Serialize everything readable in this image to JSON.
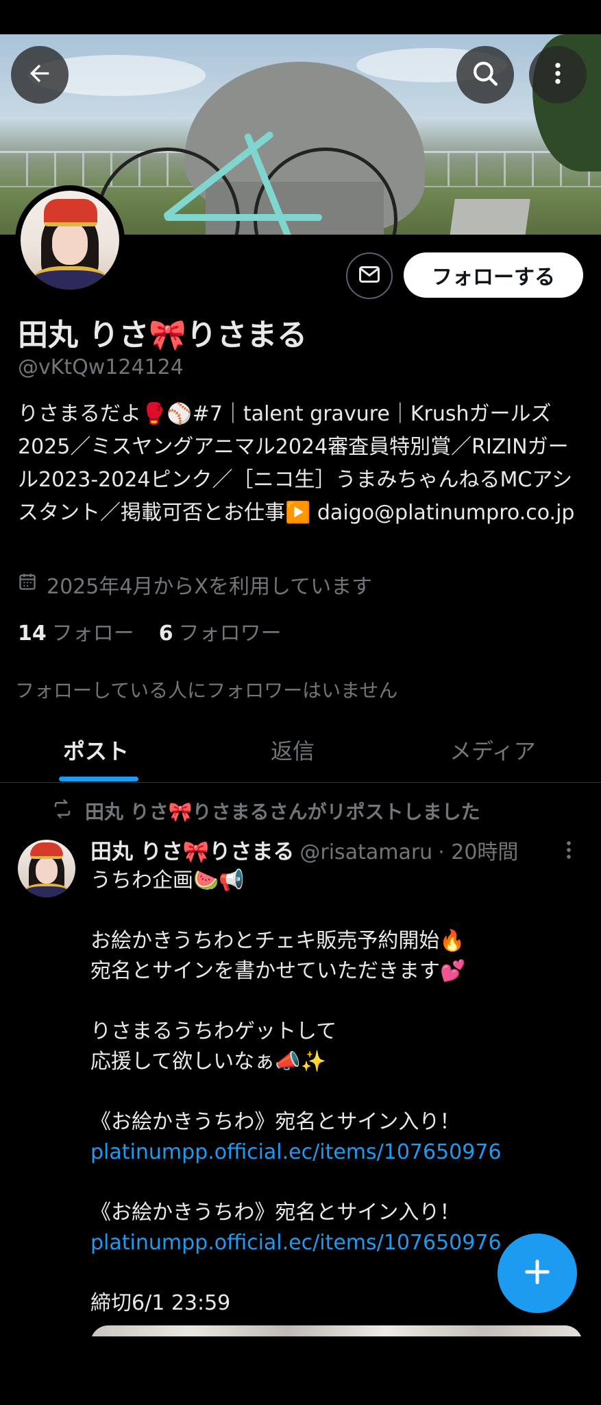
{
  "header": {
    "back_icon": "arrow-left-icon",
    "search_icon": "search-icon",
    "more_icon": "more-vertical-icon"
  },
  "profile": {
    "name": "田丸 りさ🎀りさまる",
    "handle": "@vKtQw124124",
    "follow_label": "フォローする",
    "message_icon": "envelope-icon",
    "bio": "りさまるだよ🥊⚾️#7｜talent gravure｜Krushガールズ2025／ミスヤングアニマル2024審査員特別賞／RIZINガール2023-2024ピンク／［ニコ生］うまみちゃんねるMCアシスタント／掲載可否とお仕事▶️ daigo@platinumpro.co.jp",
    "joined": "2025年4月からXを利用しています",
    "following_count": "14",
    "following_label": "フォロー",
    "followers_count": "6",
    "followers_label": "フォロワー",
    "no_followers_note": "フォローしている人にフォロワーはいません"
  },
  "tabs": [
    {
      "label": "ポスト",
      "active": true
    },
    {
      "label": "返信",
      "active": false
    },
    {
      "label": "メディア",
      "active": false
    }
  ],
  "post": {
    "repost_note": "田丸 りさ🎀りさまるさんがリポストしました",
    "author_name": "田丸 りさ🎀りさまる",
    "author_handle": "@risatamaru",
    "time": "· 20時間",
    "lines": [
      "うちわ企画🍉📢",
      "",
      "お絵かきうちわとチェキ販売予約開始🔥",
      "宛名とサインを書かせていただきます💕",
      "",
      "りさまるうちわゲットして",
      "応援して欲しいなぁ📣✨",
      "",
      "《お絵かきうちわ》宛名とサイン入り！",
      "platinumpp.official.ec/items/107650976",
      "",
      "《お絵かきうちわ》宛名とサイン入り！",
      "platinumpp.official.ec/items/107650976",
      "",
      "締切6/1 23:59"
    ]
  },
  "fab": {
    "icon": "plus-icon"
  },
  "colors": {
    "accent": "#1d9bf0",
    "background": "#000000",
    "muted": "#71767b"
  }
}
